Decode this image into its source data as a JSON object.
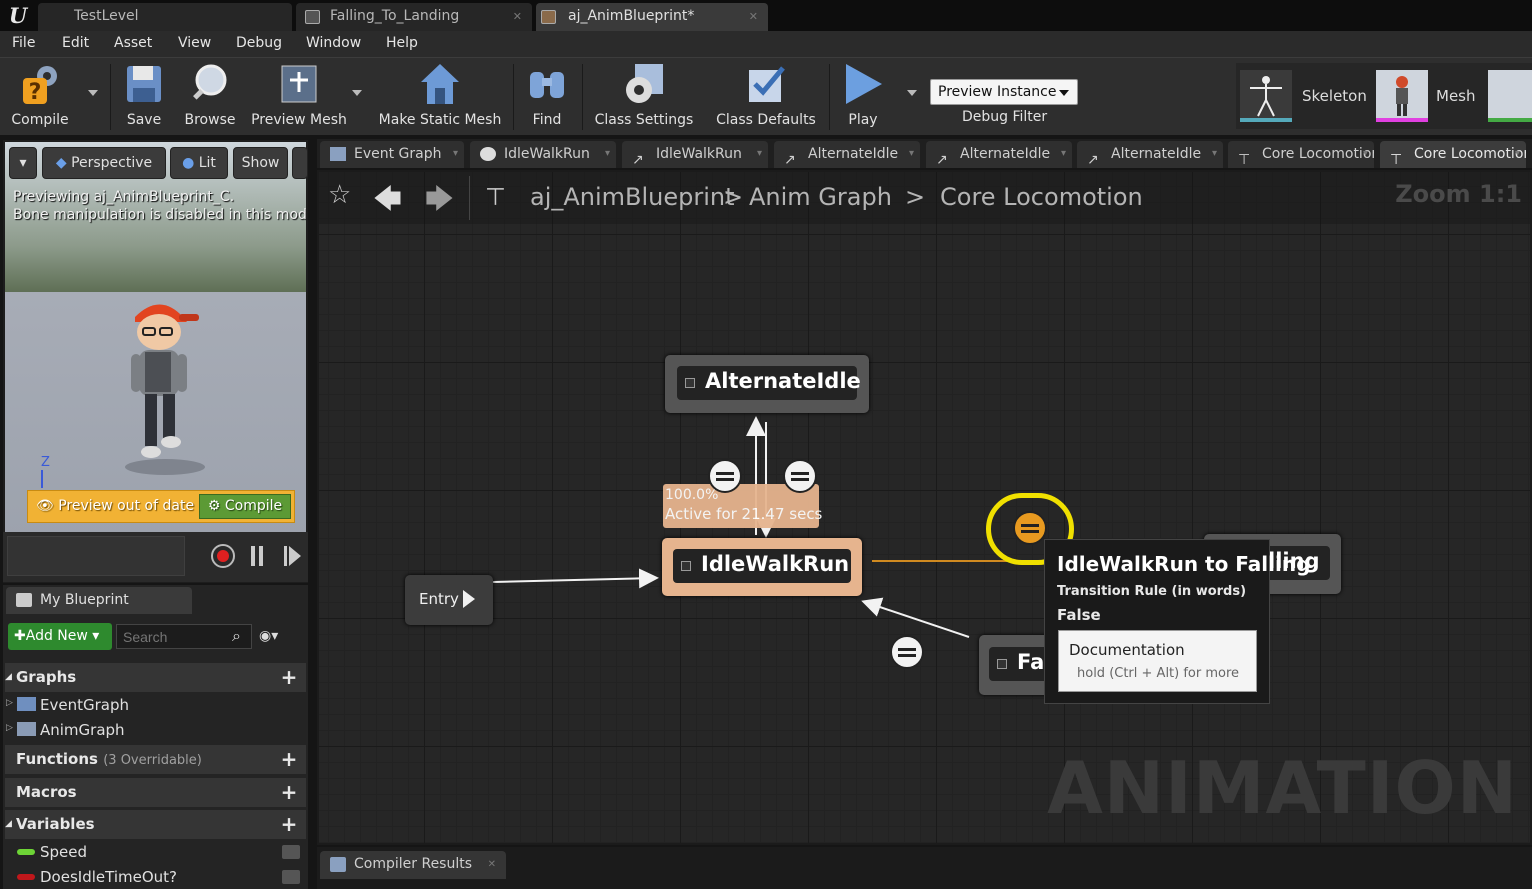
{
  "window": {
    "tabs": [
      {
        "label": "TestLevel",
        "active": false
      },
      {
        "label": "Falling_To_Landing",
        "active": false
      },
      {
        "label": "aj_AnimBlueprint*",
        "active": true
      }
    ]
  },
  "menu": [
    "File",
    "Edit",
    "Asset",
    "View",
    "Debug",
    "Window",
    "Help"
  ],
  "toolbar": {
    "compile": "Compile",
    "save": "Save",
    "browse": "Browse",
    "preview_mesh": "Preview Mesh",
    "make_static_mesh": "Make Static Mesh",
    "find": "Find",
    "class_settings": "Class Settings",
    "class_defaults": "Class Defaults",
    "play": "Play",
    "preview_instance": "Preview Instance",
    "debug_filter": "Debug Filter",
    "skeleton": "Skeleton",
    "mesh": "Mesh"
  },
  "viewport": {
    "perspective": "Perspective",
    "lit": "Lit",
    "show": "Show",
    "preview_line1": "Previewing aj_AnimBlueprint_C.",
    "preview_line2": "Bone manipulation is disabled in this mode",
    "axis_z": "Z",
    "banner_text": "Preview out of date",
    "banner_compile": "Compile"
  },
  "my_blueprint": {
    "tab": "My Blueprint",
    "add_new": "Add New",
    "search_placeholder": "Search",
    "graphs_header": "Graphs",
    "graphs": [
      "EventGraph",
      "AnimGraph"
    ],
    "functions_header": "Functions",
    "functions_note": "(3 Overridable)",
    "macros_header": "Macros",
    "variables_header": "Variables",
    "variables": [
      {
        "name": "Speed",
        "color": "#6dd436"
      },
      {
        "name": "DoesIdleTimeOut?",
        "color": "#c0171b"
      }
    ]
  },
  "graph_tabs": [
    "Event Graph",
    "IdleWalkRun",
    "IdleWalkRun",
    "AlternateIdle",
    "AlternateIdle",
    "AlternateIdle",
    "Core Locomotion",
    "Core Locomotion"
  ],
  "breadcrumb": {
    "root": "aj_AnimBlueprint",
    "sep": ">",
    "level1": "Anim Graph",
    "level2": "Core Locomotion",
    "zoom": "Zoom 1:1"
  },
  "graph": {
    "entry": "Entry",
    "states": {
      "alternate_idle": "AlternateIdle",
      "idle_walk_run": "IdleWalkRun",
      "falling_partial": "lling",
      "fa_partial": "Fa"
    },
    "active_percent": "100.0%",
    "active_time": "Active for 21.47 secs",
    "watermark": "ANIMATION",
    "accent_color": "#f0c000",
    "active_state_color": "#e6b48e"
  },
  "tooltip": {
    "title": "IdleWalkRun to Falling",
    "subtitle": "Transition Rule (in words)",
    "value": "False",
    "doc_title": "Documentation",
    "doc_hint": "hold (Ctrl + Alt) for more"
  },
  "bottom": {
    "compiler_results": "Compiler Results"
  }
}
